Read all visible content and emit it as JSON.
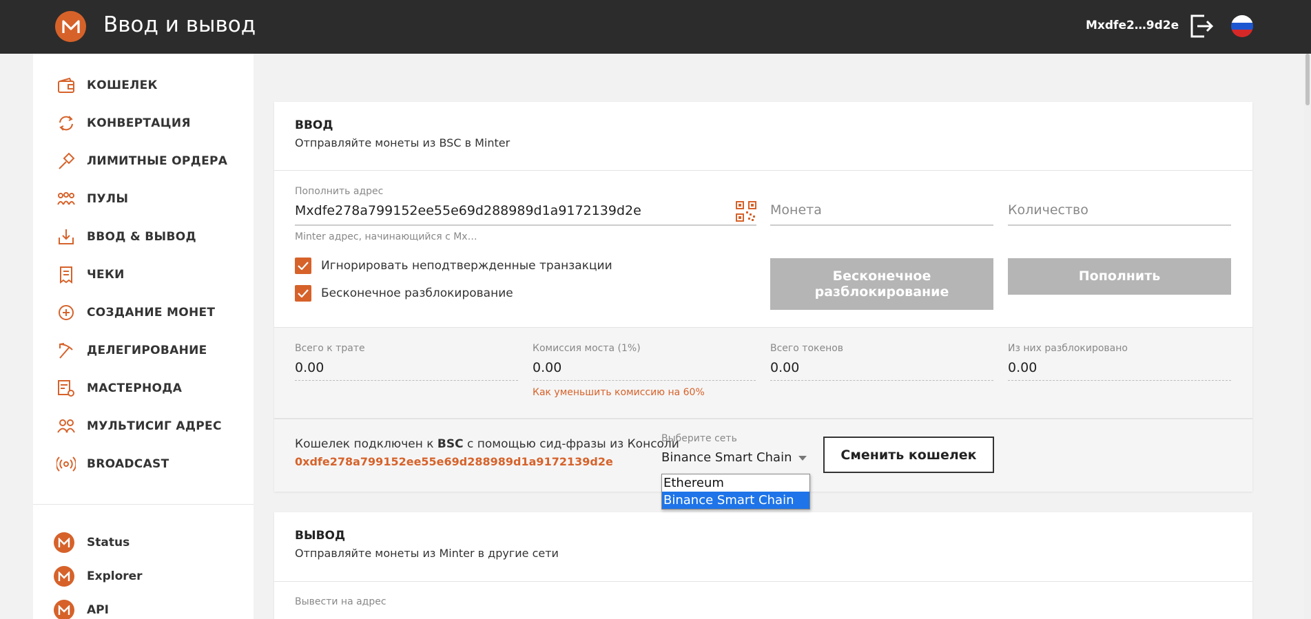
{
  "header": {
    "title": "Ввод и вывод",
    "address": "Mxdfe2…9d2e",
    "logout_icon": "logout-icon",
    "flag_icon": "russia-flag-icon"
  },
  "sidebar": {
    "items": [
      {
        "label": "КОШЕЛЕК",
        "icon": "wallet-icon"
      },
      {
        "label": "КОНВЕРТАЦИЯ",
        "icon": "convert-icon"
      },
      {
        "label": "ЛИМИТНЫЕ ОРДЕРА",
        "icon": "gavel-icon"
      },
      {
        "label": "ПУЛЫ",
        "icon": "pools-icon"
      },
      {
        "label": "ВВОД & ВЫВОД",
        "icon": "deposit-withdraw-icon"
      },
      {
        "label": "ЧЕКИ",
        "icon": "check-icon"
      },
      {
        "label": "СОЗДАНИЕ МОНЕТ",
        "icon": "create-coin-icon"
      },
      {
        "label": "ДЕЛЕГИРОВАНИЕ",
        "icon": "pickaxe-icon"
      },
      {
        "label": "МАСТЕРНОДА",
        "icon": "masternode-icon"
      },
      {
        "label": "МУЛЬТИСИГ АДРЕС",
        "icon": "multisig-icon"
      },
      {
        "label": "BROADCAST",
        "icon": "broadcast-icon"
      }
    ],
    "external": [
      {
        "label": "Status"
      },
      {
        "label": "Explorer"
      },
      {
        "label": "API"
      }
    ]
  },
  "deposit": {
    "title": "ВВОД",
    "subtitle": "Отправляйте монеты из BSC в Minter",
    "address_label": "Пополнить адрес",
    "address_value": "Mxdfe278a799152ee55e69d288989d1a9172139d2e",
    "address_hint": "Minter адрес, начинающийся с Mx…",
    "coin_placeholder": "Монета",
    "amount_placeholder": "Количество",
    "checkbox_ignore": "Игнорировать неподтвержденные транзакции",
    "checkbox_infinite": "Бесконечное разблокирование",
    "btn_infinite_unlock": "Бесконечное разблокирование",
    "btn_deposit": "Пополнить",
    "totals": [
      {
        "label": "Всего к трате",
        "value": "0.00"
      },
      {
        "label": "Комиссия моста (1%)",
        "value": "0.00"
      },
      {
        "label": "Всего токенов",
        "value": "0.00"
      },
      {
        "label": "Из них разблокировано",
        "value": "0.00"
      }
    ],
    "fee_link": "Как уменьшить комиссию на 60%",
    "wallet_pre": "Кошелек подключен к ",
    "wallet_net": "BSC",
    "wallet_post": " с помощью сид-фразы из Консоли",
    "wallet_address": "0xdfe278a799152ee55e69d288989d1a9172139d2e",
    "network_label": "Выберите сеть",
    "network_value": "Binance Smart Chain",
    "network_options": [
      "Ethereum",
      "Binance Smart Chain"
    ],
    "btn_change_wallet": "Сменить кошелек"
  },
  "withdraw": {
    "title": "ВЫВОД",
    "subtitle": "Отправляйте монеты из Minter в другие сети",
    "address_label": "Вывести на адрес"
  },
  "colors": {
    "accent": "#d6622a",
    "header_bg": "#2c2c2c",
    "button_disabled": "#b5b5b5",
    "select_highlight": "#1e74e8"
  }
}
